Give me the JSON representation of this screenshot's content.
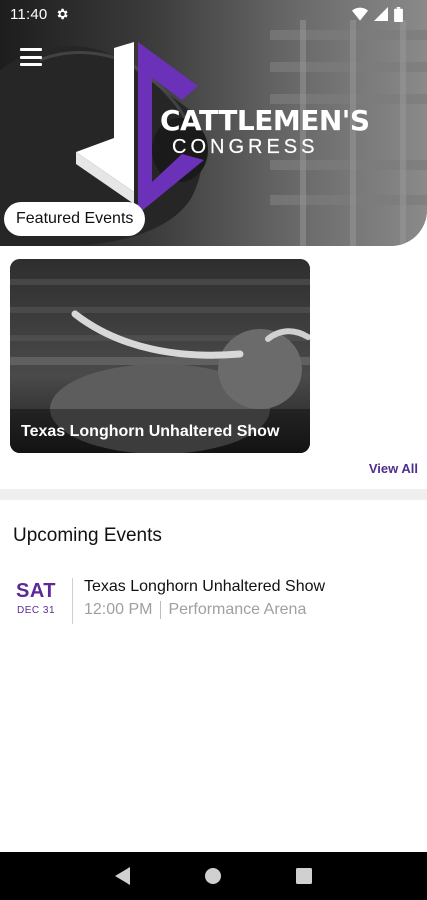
{
  "status_bar": {
    "time": "11:40",
    "icons": [
      "settings-icon",
      "wifi-icon",
      "signal-icon",
      "battery-icon"
    ]
  },
  "header": {
    "menu_icon": "hamburger-menu-icon",
    "logo_title": "CATTLEMEN'S",
    "logo_subtitle": "CONGRESS",
    "featured_label": "Featured Events"
  },
  "featured": {
    "cards": [
      {
        "title": "Texas Longhorn Unhaltered Show"
      }
    ],
    "view_all_label": "View All"
  },
  "upcoming": {
    "title": "Upcoming Events",
    "events": [
      {
        "day": "SAT",
        "date": "DEC 31",
        "name": "Texas Longhorn Unhaltered Show",
        "time": "12:00 PM",
        "location": "Performance Arena"
      }
    ]
  },
  "nav_bar": {
    "icons": [
      "back-icon",
      "home-icon",
      "recents-icon"
    ]
  },
  "colors": {
    "brand_purple": "#5b2a96",
    "view_all": "#4f2d8e",
    "nav_bar": "#000000"
  }
}
